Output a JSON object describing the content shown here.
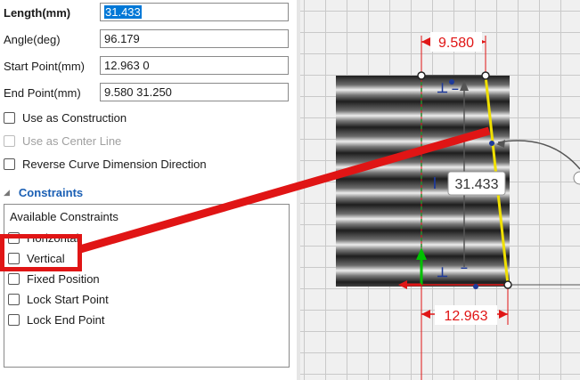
{
  "properties": {
    "length": {
      "label": "Length(mm)",
      "value": "31.433"
    },
    "angle": {
      "label": "Angle(deg)",
      "value": "96.179"
    },
    "start_point": {
      "label": "Start Point(mm)",
      "value": "12.963 0"
    },
    "end_point": {
      "label": "End Point(mm)",
      "value": "9.580 31.250"
    }
  },
  "options": {
    "use_as_construction": "Use as Construction",
    "use_as_center_line": "Use as Center Line",
    "reverse_direction": "Reverse Curve Dimension Direction"
  },
  "constraints": {
    "title": "Constraints",
    "box_title": "Available Constraints",
    "items": [
      "Horizontal",
      "Vertical",
      "Fixed Position",
      "Lock Start Point",
      "Lock End Point"
    ]
  },
  "canvas": {
    "dim_top": "9.580",
    "dim_length": "31.433",
    "dim_bottom": "12.963",
    "colors": {
      "dimension": "#e01515",
      "selected_line": "#f0e000",
      "highlight": "#e01515"
    }
  }
}
